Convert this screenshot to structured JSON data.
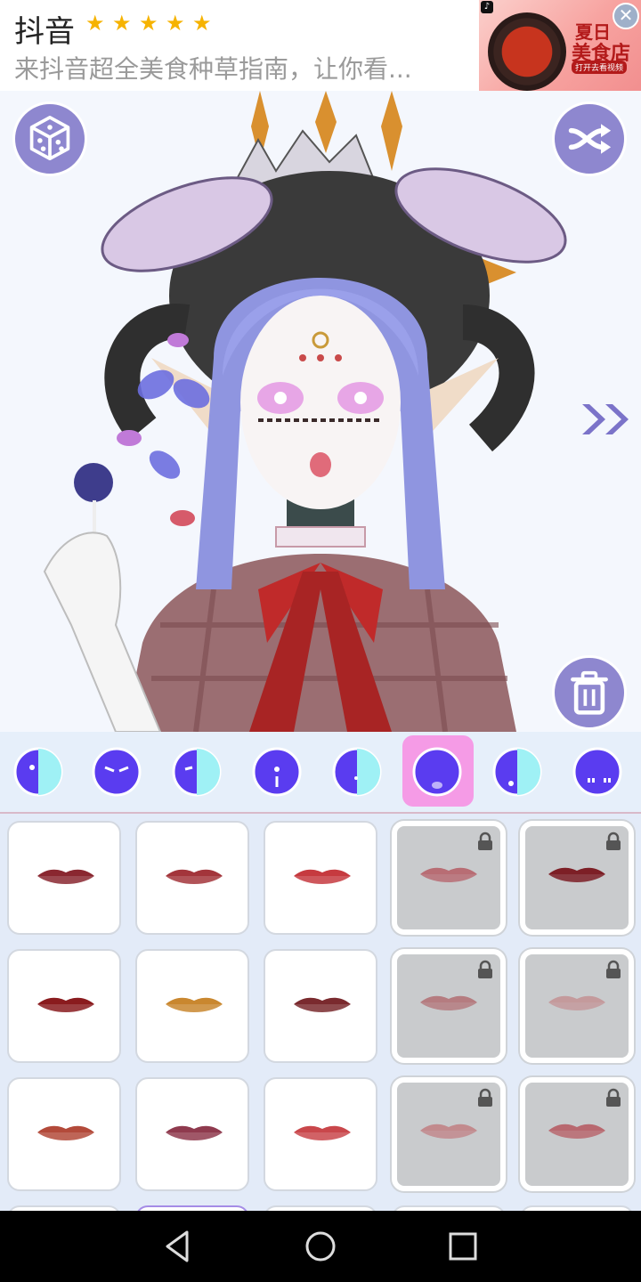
{
  "ad": {
    "app_name": "抖音",
    "rating_stars": 5,
    "description": "来抖音超全美食种草指南，让你看...",
    "thumb_line1": "夏日",
    "thumb_line2": "美食店",
    "thumb_cta": "打开去看视频",
    "close_icon": "close-icon"
  },
  "stage": {
    "random_button_icon": "dice-icon",
    "shuffle_button_icon": "shuffle-icon",
    "next_icon": "double-chevron-right-icon",
    "delete_button_icon": "trash-icon"
  },
  "tabs": {
    "selected_index": 5,
    "items": [
      {
        "name": "tab-face-half",
        "icon": "face-half-icon"
      },
      {
        "name": "tab-eyebrows",
        "icon": "eyebrows-icon"
      },
      {
        "name": "tab-eyes",
        "icon": "eyes-icon"
      },
      {
        "name": "tab-nose",
        "icon": "nose-icon"
      },
      {
        "name": "tab-blush",
        "icon": "blush-icon"
      },
      {
        "name": "tab-mouth",
        "icon": "mouth-icon"
      },
      {
        "name": "tab-chin",
        "icon": "chin-icon"
      },
      {
        "name": "tab-face-marks",
        "icon": "face-marks-icon"
      }
    ]
  },
  "grid": {
    "items": [
      {
        "locked": false,
        "color": "#8a2730"
      },
      {
        "locked": false,
        "color": "#a3353b"
      },
      {
        "locked": false,
        "color": "#c63a3f"
      },
      {
        "locked": true,
        "color": "#b86d74"
      },
      {
        "locked": true,
        "color": "#7d1f26"
      },
      {
        "locked": false,
        "color": "#8a1b1e"
      },
      {
        "locked": false,
        "color": "#c9872f"
      },
      {
        "locked": false,
        "color": "#7a2a2e"
      },
      {
        "locked": true,
        "color": "#b57c80"
      },
      {
        "locked": true,
        "color": "#c49a9c"
      },
      {
        "locked": false,
        "color": "#b34a3a"
      },
      {
        "locked": false,
        "color": "#8f3a4e"
      },
      {
        "locked": false,
        "color": "#c9474b"
      },
      {
        "locked": true,
        "color": "#c28a8d"
      },
      {
        "locked": true,
        "color": "#b8686f"
      }
    ]
  },
  "navbar": {
    "back_icon": "back-triangle-icon",
    "home_icon": "home-circle-icon",
    "recents_icon": "recents-square-icon"
  },
  "colors": {
    "accent": "#8e87cf",
    "tab_bar": "#e6effa",
    "selected_tab": "#f59be6",
    "tab_icon": "#5a3cf0",
    "grid_bg": "#e3ebf8"
  }
}
